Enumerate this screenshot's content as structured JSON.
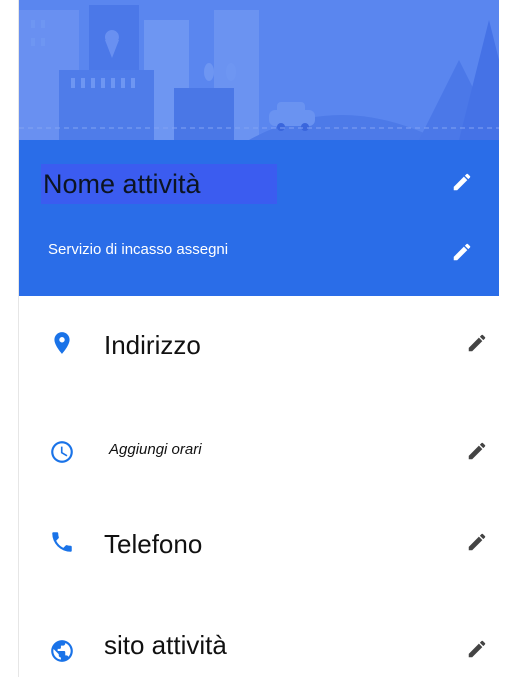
{
  "header": {
    "name_label": "Nome attività",
    "category_label": "Servizio di incasso assegni"
  },
  "fields": [
    {
      "label": "Indirizzo",
      "icon": "location-pin-icon"
    },
    {
      "label": "Aggiungi orari",
      "icon": "clock-icon"
    },
    {
      "label": "Telefono",
      "icon": "phone-icon"
    },
    {
      "label": "sito attività",
      "icon": "globe-icon"
    }
  ],
  "colors": {
    "hero_bg": "#5a86ef",
    "header_bg": "#2a6de8",
    "name_highlight": "#3b5cf0",
    "accent_blue": "#1a73e8",
    "edit_icon_gray": "#444444"
  }
}
